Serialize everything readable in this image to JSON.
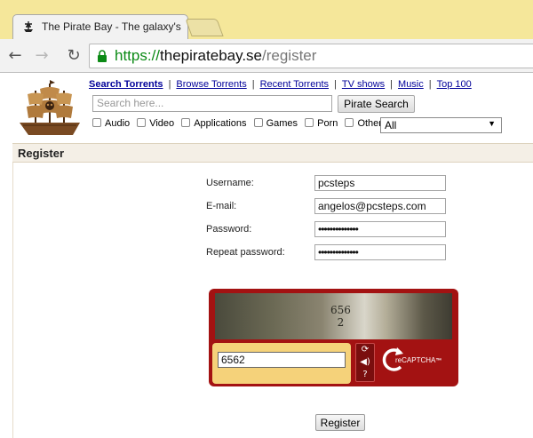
{
  "browser": {
    "tab_title": "The Pirate Bay - The galaxy's most resilient BitTorrent site",
    "url_scheme": "https://",
    "url_host": "thepiratebay.se",
    "url_path": "/register"
  },
  "nav": {
    "links": [
      "Search Torrents",
      "Browse Torrents",
      "Recent Torrents",
      "TV shows",
      "Music",
      "Top 100"
    ],
    "separator": "|"
  },
  "search": {
    "placeholder": "Search here...",
    "button_label": "Pirate Search",
    "categories": [
      "Audio",
      "Video",
      "Applications",
      "Games",
      "Porn",
      "Other"
    ],
    "select_value": "All"
  },
  "section": {
    "title": "Register"
  },
  "form": {
    "username_label": "Username:",
    "username_value": "pcsteps",
    "email_label": "E-mail:",
    "email_value": "angelos@pcsteps.com",
    "password_label": "Password:",
    "password_value": "••••••••••••••",
    "repeat_label": "Repeat password:",
    "repeat_value": "••••••••••••••"
  },
  "captcha": {
    "image_text_1": "656",
    "image_text_2": "2",
    "answer": "6562",
    "logo_re": "re",
    "logo_captcha": "CAPTCHA",
    "logo_tm": "™"
  },
  "register_button": "Register"
}
